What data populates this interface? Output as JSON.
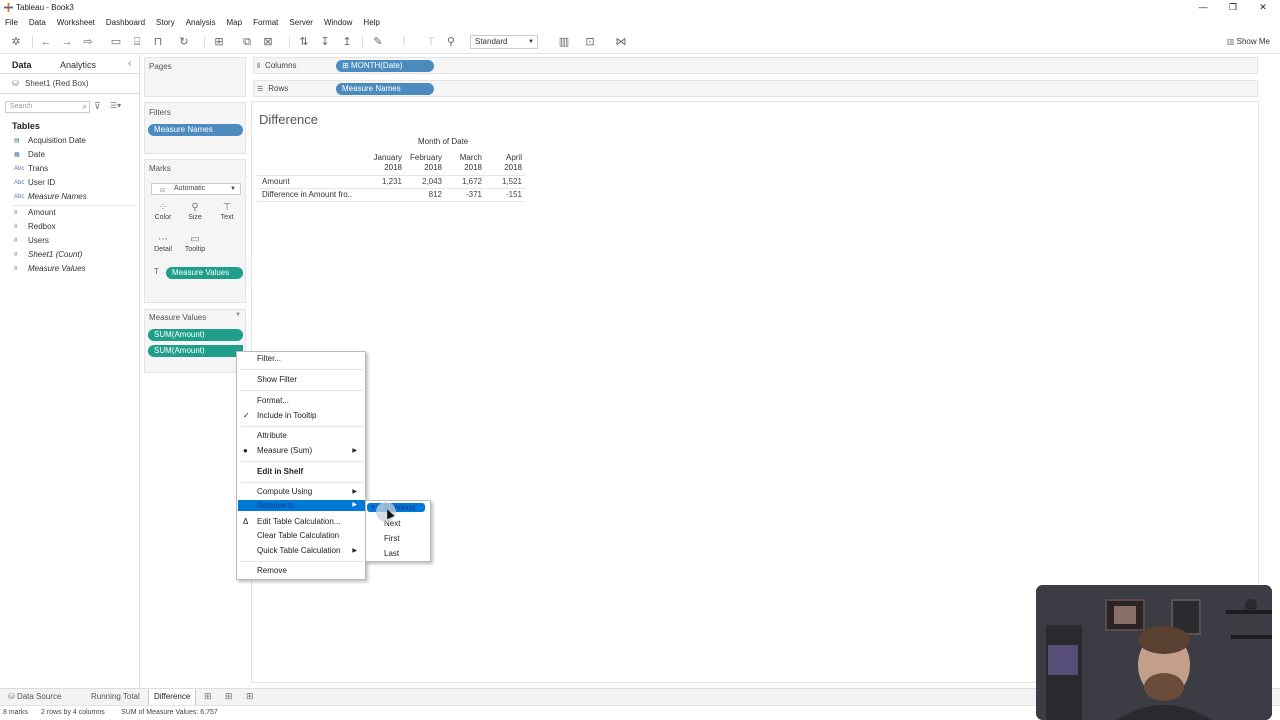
{
  "window": {
    "title": "Tableau - Book3",
    "minimize": "—",
    "restore": "❐",
    "close": "✕"
  },
  "menu": [
    "File",
    "Data",
    "Worksheet",
    "Dashboard",
    "Story",
    "Analysis",
    "Map",
    "Format",
    "Server",
    "Window",
    "Help"
  ],
  "toolbar": {
    "fit_select": "Standard",
    "show_me": "Show Me"
  },
  "data_pane": {
    "tab_data": "Data",
    "tab_analytics": "Analytics",
    "data_source": "Sheet1 (Red Box)",
    "search_placeholder": "Search",
    "tables_heading": "Tables",
    "dimensions": [
      {
        "type": "date-set",
        "label": "Acquisition Date"
      },
      {
        "type": "date",
        "label": "Date"
      },
      {
        "type": "Abc",
        "label": "Trans"
      },
      {
        "type": "Abc",
        "label": "User ID"
      },
      {
        "type": "Abc",
        "label": "Measure Names"
      }
    ],
    "measures": [
      {
        "type": "#",
        "label": "Amount"
      },
      {
        "type": "#",
        "label": "Redbox"
      },
      {
        "type": "#",
        "label": "Users"
      },
      {
        "type": "#",
        "label": "Sheet1 (Count)"
      },
      {
        "type": "#",
        "label": "Measure Values"
      }
    ]
  },
  "cards": {
    "pages": "Pages",
    "filters": "Filters",
    "filter_pill": "Measure Names",
    "marks": "Marks",
    "marks_type": "Automatic",
    "mark_buttons": [
      "Color",
      "Size",
      "Text",
      "Detail",
      "Tooltip"
    ],
    "marks_pill": "Measure Values",
    "measure_values": "Measure Values",
    "mv_pills": [
      "SUM(Amount)",
      "SUM(Amount)"
    ]
  },
  "shelves": {
    "columns_label": "Columns",
    "columns_pill": "MONTH(Date)",
    "rows_label": "Rows",
    "rows_pill": "Measure Names"
  },
  "view": {
    "title": "Difference",
    "column_header_title": "Month of Date",
    "columns": [
      {
        "month": "January",
        "year": "2018"
      },
      {
        "month": "February",
        "year": "2018"
      },
      {
        "month": "March",
        "year": "2018"
      },
      {
        "month": "April",
        "year": "2018"
      }
    ],
    "rows": [
      {
        "label": "Amount",
        "values": [
          "1,231",
          "2,043",
          "1,672",
          "1,521"
        ]
      },
      {
        "label": "Difference in Amount fro..",
        "values": [
          "",
          "812",
          "-371",
          "-151"
        ]
      }
    ]
  },
  "context_menu": {
    "items": {
      "filter": "Filter...",
      "show_filter": "Show Filter",
      "format": "Format...",
      "include_tooltip": "Include in Tooltip",
      "attribute": "Attribute",
      "measure": "Measure (Sum)",
      "edit_shelf": "Edit in Shelf",
      "compute_using": "Compute Using",
      "relative_to": "Relative to",
      "edit_table_calc": "Edit Table Calculation...",
      "clear_table_calc": "Clear Table Calculation",
      "quick_table_calc": "Quick Table Calculation",
      "remove": "Remove"
    },
    "submenu": [
      "Previous",
      "Next",
      "First",
      "Last"
    ]
  },
  "bottom_tabs": {
    "data_source": "Data Source",
    "sheets": [
      "Running Total",
      "Difference"
    ]
  },
  "status": {
    "marks": "8 marks",
    "dims": "2 rows by 4 columns",
    "sum": "SUM of Measure Values: 6,757"
  },
  "colors": {
    "accent_blue": "#4b8bbf",
    "accent_green": "#1f9e89",
    "menu_highlight": "#0078d7"
  }
}
